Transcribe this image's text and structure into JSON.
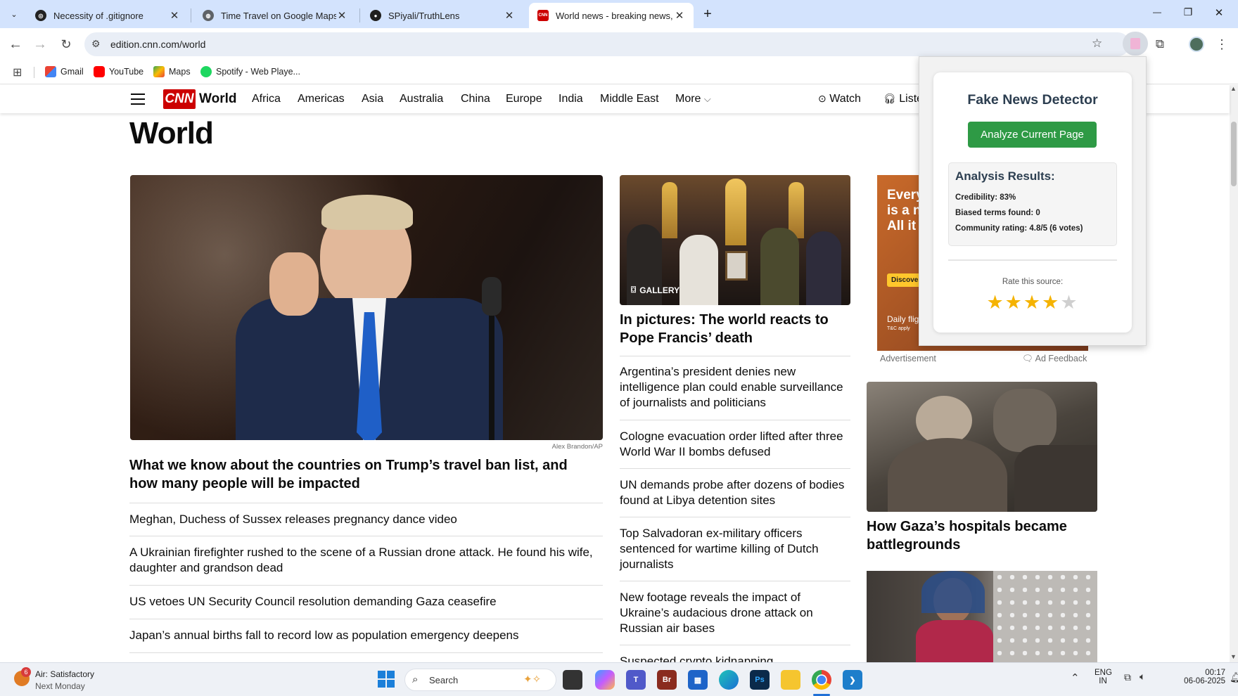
{
  "tabs": [
    {
      "title": "Necessity of .gitignore",
      "close": "✕"
    },
    {
      "title": "Time Travel on Google Maps",
      "close": "✕"
    },
    {
      "title": "SPiyali/TruthLens",
      "close": "✕"
    },
    {
      "title": "World news - breaking news, vi",
      "close": "✕",
      "favicon_text": "CNN"
    }
  ],
  "new_tab": "+",
  "window_controls": {
    "minimize": "—",
    "maximize": "❐",
    "close": "✕"
  },
  "address_bar": {
    "url": "edition.cnn.com/world"
  },
  "bookmarks": [
    {
      "label": "Gmail"
    },
    {
      "label": "YouTube"
    },
    {
      "label": "Maps"
    },
    {
      "label": "Spotify - Web Playe..."
    }
  ],
  "cnn_nav": {
    "logo": "CNN",
    "section": "World",
    "links": [
      "Africa",
      "Americas",
      "Asia",
      "Australia",
      "China",
      "Europe",
      "India",
      "Middle East",
      "More"
    ],
    "watch": "Watch",
    "listen": "Liste"
  },
  "page": {
    "title": "World",
    "lead": {
      "image_credit": "Alex Brandon/AP",
      "headline": "What we know about the countries on Trump’s travel ban list, and how many people will be impacted"
    },
    "left_stories": [
      "Meghan, Duchess of Sussex releases pregnancy dance video",
      "A Ukrainian firefighter rushed to the scene of a Russian drone attack. He found his wife, daughter and grandson dead",
      "US vetoes UN Security Council resolution demanding Gaza ceasefire",
      "Japan’s annual births fall to record low as population emergency deepens"
    ],
    "middle": {
      "gallery_label": "GALLERY",
      "headline": "In pictures: The world reacts to Pope Francis’ death",
      "stories": [
        "Argentina’s president denies new intelligence plan could enable surveillance of journalists and politicians",
        "Cologne evacuation order lifted after three World War II bombs defused",
        "UN demands probe after dozens of bodies found at Libya detention sites",
        "Top Salvadoran ex-military officers sentenced for wartime killing of Dutch journalists",
        "New footage reveals the impact of Ukraine’s audacious drone attack on Russian air bases",
        "Suspected crypto kidnapping"
      ]
    },
    "ad": {
      "lines": [
        "Every",
        "is a n",
        "All it t"
      ],
      "button": "Discover",
      "footer": "Daily flig",
      "tc": "T&C apply",
      "label": "Advertisement",
      "feedback": "Ad Feedback"
    },
    "right": {
      "headline": "How Gaza’s hospitals became battlegrounds"
    }
  },
  "extension_popup": {
    "title": "Fake News Detector",
    "analyze_button": "Analyze Current Page",
    "results_title": "Analysis Results:",
    "credibility": "Credibility: 83%",
    "biased_terms": "Biased terms found: 0",
    "community_rating": "Community rating: 4.8/5 (6 votes)",
    "rate_label": "Rate this source:",
    "stars_filled": 4,
    "stars_total": 5,
    "star_color": "#f5b301"
  },
  "taskbar": {
    "weather_badge": "6",
    "weather_title": "Air: Satisfactory",
    "weather_sub": "Next Monday",
    "search_placeholder": "Search",
    "lang_top": "ENG",
    "lang_bottom": "IN",
    "time": "00:17",
    "date": "06-06-2025"
  },
  "colors": {
    "cnn_red": "#cc0000",
    "tabstrip": "#d3e3fd",
    "analyze_green": "#2e9a45"
  }
}
